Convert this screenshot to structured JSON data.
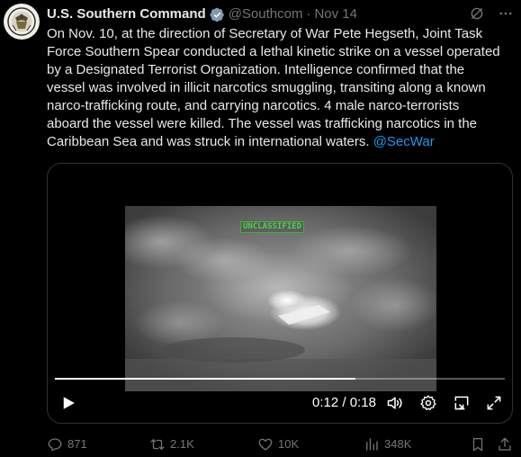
{
  "author": {
    "display_name": "U.S. Southern Command",
    "handle": "@Southcom",
    "separator": "·",
    "timestamp": "Nov 14"
  },
  "tweet_lines": [
    "On Nov. 10, at the direction of Secretary of War Pete Hegseth, Joint Task",
    "Force Southern Spear conducted a lethal kinetic strike on a vessel operated",
    "by a Designated Terrorist Organization. Intelligence confirmed that the",
    "vessel was involved in illicit narcotics smuggling, transiting along a known",
    "narco-trafficking route, and carrying narcotics. 4 male narco-terrorists",
    "aboard the vessel were killed. The vessel was trafficking narcotics in the",
    "Caribbean Sea and was struck in international waters."
  ],
  "mention": "@SecWar",
  "video": {
    "overlay_label": "UNCLASSIFIED",
    "current_time": "0:12",
    "time_separator": "/",
    "duration": "0:18",
    "progress_fraction": 0.667
  },
  "actions": {
    "replies": "871",
    "reposts": "2.1K",
    "likes": "10K",
    "views": "348K"
  },
  "colors": {
    "background": "#000000",
    "text": "#e7e9ea",
    "muted": "#71767b",
    "link": "#1d9bf0",
    "verified_badge": "#829aab",
    "border": "#2f3336"
  },
  "icons": {
    "verified": "verified-badge-icon",
    "grok": "grok-icon",
    "more": "more-icon",
    "play": "play-icon",
    "volume": "volume-icon",
    "settings": "settings-gear-icon",
    "pip": "picture-in-picture-icon",
    "fullscreen": "fullscreen-icon",
    "reply": "reply-icon",
    "repost": "repost-icon",
    "like": "like-heart-icon",
    "views": "views-chart-icon",
    "bookmark": "bookmark-icon",
    "share": "share-icon"
  }
}
